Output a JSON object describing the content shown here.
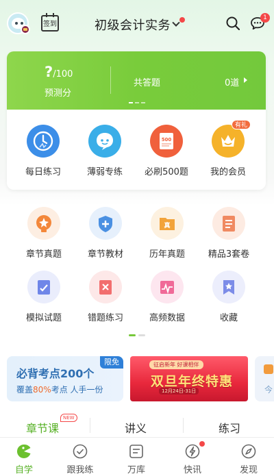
{
  "header": {
    "checkin_label": "签到",
    "subject": "初级会计实务",
    "message_count": "1"
  },
  "score_card": {
    "predict_value": "?",
    "predict_total": "/100",
    "predict_label": "预测分",
    "total_label": "共答题",
    "total_value": "0道",
    "quick_actions": [
      {
        "label": "每日练习",
        "icon": "daily-practice-icon",
        "color": "#3c8ee8"
      },
      {
        "label": "薄弱专练",
        "icon": "weak-practice-icon",
        "color": "#3aaee8"
      },
      {
        "label": "必刷500题",
        "icon": "must-do-500-icon",
        "color": "#f0603c"
      },
      {
        "label": "我的会员",
        "icon": "membership-icon",
        "color": "#f5b22a"
      }
    ],
    "gift_tag": "有礼"
  },
  "function_grid": [
    {
      "label": "章节真题",
      "icon": "chapter-exam-icon",
      "color": "#f3873a",
      "bg": "#fdeee2"
    },
    {
      "label": "章节教材",
      "icon": "chapter-textbook-icon",
      "color": "#4a90e2",
      "bg": "#e6f0fc"
    },
    {
      "label": "历年真题",
      "icon": "past-exams-icon",
      "color": "#f2a33a",
      "bg": "#fdf1e0"
    },
    {
      "label": "精品3套卷",
      "icon": "premium-papers-icon",
      "color": "#f08a62",
      "bg": "#fdebe2"
    },
    {
      "label": "模拟试题",
      "icon": "mock-exam-icon",
      "color": "#6f86e8",
      "bg": "#eaedfc"
    },
    {
      "label": "错题练习",
      "icon": "wrong-questions-icon",
      "color": "#f26e6e",
      "bg": "#fde8e8"
    },
    {
      "label": "高频数据",
      "icon": "high-frequency-icon",
      "color": "#f06a98",
      "bg": "#fde6ef"
    },
    {
      "label": "收藏",
      "icon": "favorites-icon",
      "color": "#7c8ce8",
      "bg": "#eceefc"
    }
  ],
  "banners": {
    "b1_title": "必背考点200个",
    "b1_sub_prefix": "覆盖",
    "b1_sub_highlight": "80%",
    "b1_sub_suffix": "考点 人手一份",
    "b1_tag": "限免",
    "b2_top": "征启新年 好课相伴",
    "b2_title": "双旦年终特惠",
    "b2_date": "12月24日-31日",
    "b3_text": "今"
  },
  "tabs": [
    {
      "label": "章节课",
      "active": true
    },
    {
      "label": "讲义",
      "active": false
    },
    {
      "label": "练习",
      "active": false
    }
  ],
  "new_badge": "NEW",
  "bottom_nav": [
    {
      "label": "自学",
      "icon": "self-study-icon",
      "active": true
    },
    {
      "label": "跟我练",
      "icon": "practice-with-me-icon",
      "active": false
    },
    {
      "label": "万库",
      "icon": "question-bank-icon",
      "active": false
    },
    {
      "label": "快讯",
      "icon": "news-flash-icon",
      "active": false
    },
    {
      "label": "发现",
      "icon": "discover-icon",
      "active": false
    }
  ],
  "colors": {
    "accent_green": "#76c83a",
    "alert_red": "#f44848"
  }
}
